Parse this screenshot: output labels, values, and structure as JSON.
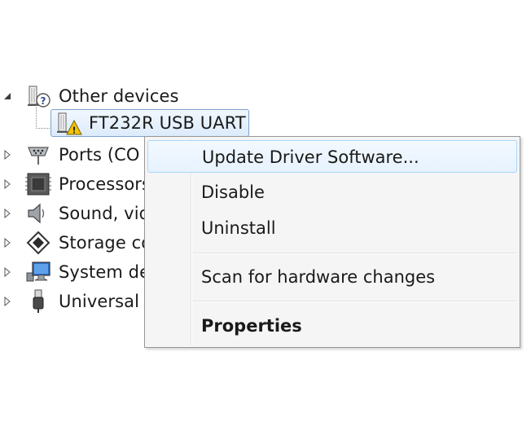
{
  "tree": {
    "category": {
      "label": "Other devices",
      "icon": "unknown-device-icon",
      "expanded": true
    },
    "selected_device": {
      "label": "FT232R USB UART",
      "icon": "warning-device-icon"
    },
    "items": [
      {
        "label": "Ports (CO",
        "icon": "ports-icon"
      },
      {
        "label": "Processors",
        "icon": "processor-icon"
      },
      {
        "label": "Sound, vid",
        "icon": "sound-icon"
      },
      {
        "label": "Storage co",
        "icon": "storage-icon"
      },
      {
        "label": "System de",
        "icon": "system-devices-icon"
      },
      {
        "label": "Universal S",
        "icon": "usb-icon"
      }
    ]
  },
  "context_menu": {
    "items": [
      {
        "label": "Update Driver Software...",
        "highlighted": true
      },
      {
        "label": "Disable"
      },
      {
        "label": "Uninstall"
      },
      {
        "label": "Scan for hardware changes"
      },
      {
        "label": "Properties",
        "bold": true
      }
    ]
  },
  "colors": {
    "selection_border": "#7da2ce",
    "menu_hover_border": "#a8d8f8",
    "menu_background": "#f5f5f5",
    "warning": "#f5c400"
  }
}
